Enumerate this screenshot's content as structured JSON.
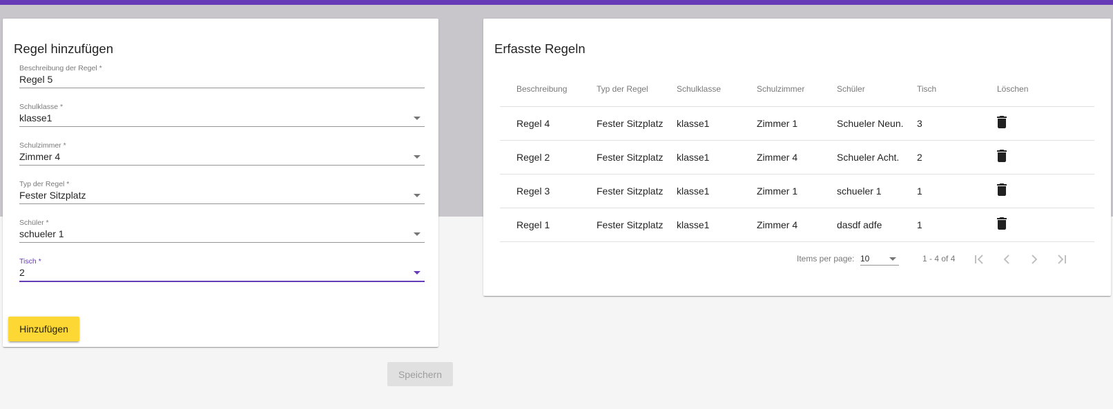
{
  "form": {
    "title": "Regel hinzufügen",
    "fields": [
      {
        "label": "Beschreibung der Regel *",
        "value": "Regel 5"
      },
      {
        "label": "Schulklasse *",
        "value": "klasse1"
      },
      {
        "label": "Schulzimmer *",
        "value": "Zimmer 4"
      },
      {
        "label": "Typ der Regel *",
        "value": "Fester Sitzplatz"
      },
      {
        "label": "Schüler *",
        "value": "schueler 1"
      },
      {
        "label": "Tisch *",
        "value": "2"
      }
    ],
    "add_button": "Hinzufügen"
  },
  "save_button": "Speichern",
  "rules": {
    "title": "Erfasste Regeln",
    "columns": [
      "Beschreibung",
      "Typ der Regel",
      "Schulklasse",
      "Schulzimmer",
      "Schüler",
      "Tisch",
      "Löschen"
    ],
    "rows": [
      [
        "Regel 4",
        "Fester Sitzplatz",
        "klasse1",
        "Zimmer 1",
        "Schueler Neun.",
        "3"
      ],
      [
        "Regel 2",
        "Fester Sitzplatz",
        "klasse1",
        "Zimmer 4",
        "Schueler Acht.",
        "2"
      ],
      [
        "Regel 3",
        "Fester Sitzplatz",
        "klasse1",
        "Zimmer 1",
        "schueler 1",
        "1"
      ],
      [
        "Regel 1",
        "Fester Sitzplatz",
        "klasse1",
        "Zimmer 4",
        "dasdf adfe",
        "1"
      ]
    ],
    "delete_icon": "trash-icon"
  },
  "paginator": {
    "items_per_page_label": "Items per page:",
    "page_size": "10",
    "range": "1 - 4 of 4",
    "icons": [
      "first-page-icon",
      "previous-page-icon",
      "next-page-icon",
      "last-page-icon"
    ]
  },
  "colors": {
    "primary": "#673ab7",
    "accent": "#fdd835",
    "header_band": "#c8c6cb"
  }
}
